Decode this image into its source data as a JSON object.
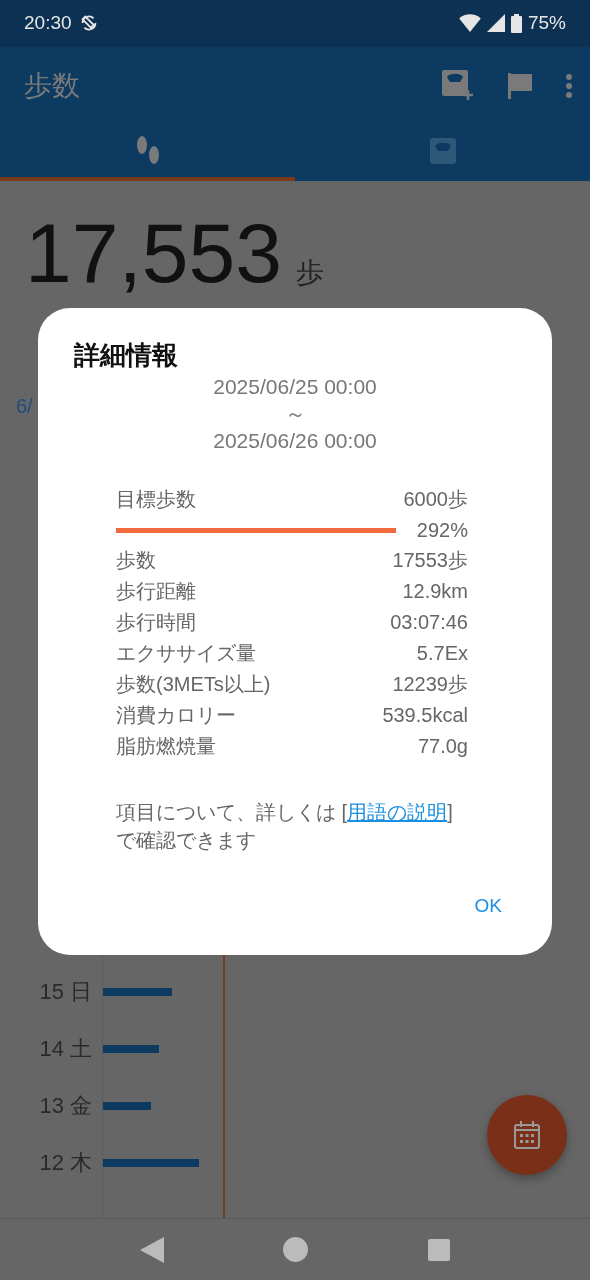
{
  "status_bar": {
    "time": "20:30",
    "battery": "75%"
  },
  "app_bar": {
    "title": "歩数"
  },
  "tabs": [
    {
      "kind": "steps",
      "selected": true
    },
    {
      "kind": "scale",
      "selected": false
    }
  ],
  "summary": {
    "steps": "17,553",
    "unit": "歩",
    "date": "6/"
  },
  "daily_chart": {
    "rows": [
      {
        "label": "15 日"
      },
      {
        "label": "14 土"
      },
      {
        "label": "13 金"
      },
      {
        "label": "12 木"
      }
    ]
  },
  "dialog": {
    "title": "詳細情報",
    "range_start": "2025/06/25 00:00",
    "range_separator": "～",
    "range_end": "2025/06/26 00:00",
    "goal": {
      "label": "目標歩数",
      "value": "6000歩",
      "percent": "292%",
      "level": 1
    },
    "rows": [
      {
        "label": "歩数",
        "value": "17553歩"
      },
      {
        "label": "歩行距離",
        "value": "12.9km"
      },
      {
        "label": "歩行時間",
        "value": "03:07:46"
      },
      {
        "label": "エクササイズ量",
        "value": "5.7Ex"
      },
      {
        "label": "歩数(3METs以上)",
        "value": "12239歩"
      },
      {
        "label": "消費カロリー",
        "value": "539.5kcal"
      },
      {
        "label": "脂肪燃焼量",
        "value": "77.0g"
      }
    ],
    "note_before": "項目について、詳しくは [",
    "note_link": "用語の説明",
    "note_after": "] で確認できます",
    "button": "OK"
  }
}
